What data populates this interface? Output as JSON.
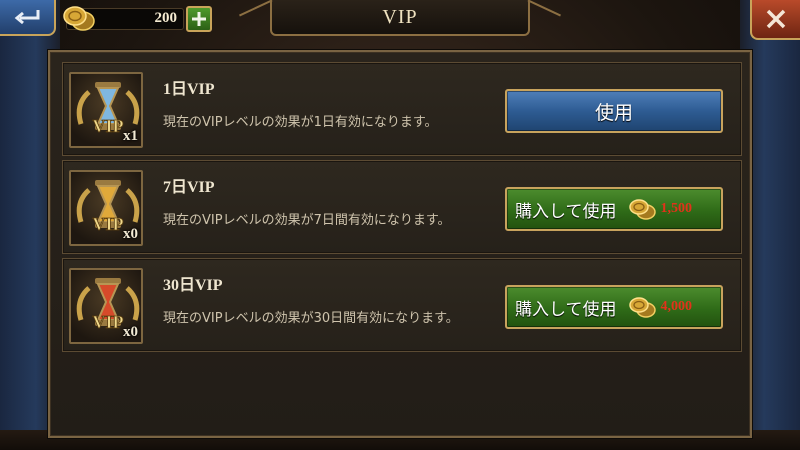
{
  "header": {
    "title": "VIP",
    "coin_balance": "200",
    "back_icon": "back-arrow-icon",
    "close_icon": "close-icon",
    "add_icon": "plus-icon"
  },
  "items": [
    {
      "name": "1日VIP",
      "quantity": "x1",
      "description": "現在のVIPレベルの効果が1日有効になります。",
      "button_label": "使用",
      "price": null,
      "icon": "vip-hourglass-icon"
    },
    {
      "name": "7日VIP",
      "quantity": "x0",
      "description": "現在のVIPレベルの効果が7日間有効になります。",
      "button_label": "購入して使用",
      "price": "1,500",
      "icon": "vip-hourglass-gold-icon"
    },
    {
      "name": "30日VIP",
      "quantity": "x0",
      "description": "現在のVIPレベルの効果が30日間有効になります。",
      "button_label": "購入して使用",
      "price": "4,000",
      "icon": "vip-hourglass-red-icon"
    }
  ],
  "colors": {
    "price_red": "#e2321a",
    "button_blue": "#2e5c93",
    "button_green": "#2f6b18",
    "gold_border": "#c8a35d"
  }
}
